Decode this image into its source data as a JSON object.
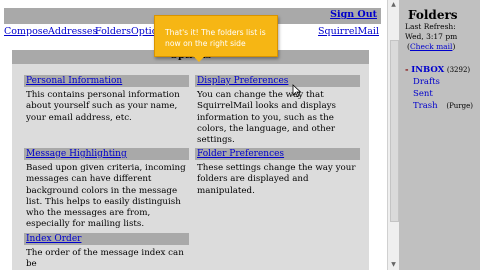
{
  "header": {
    "signout_label": "Sign Out"
  },
  "menu": {
    "compose": "Compose",
    "addresses": "Addresses",
    "folders": "Folders",
    "options": "Optio",
    "brand": "SquirrelMail"
  },
  "options_panel": {
    "title": "Options"
  },
  "blocks": {
    "personal": {
      "title": "Personal Information",
      "desc": "This contains personal information about yourself such as your name, your email address, etc."
    },
    "display": {
      "title": "Display Preferences",
      "desc": "You can change the way that SquirrelMail looks and displays information to you, such as the colors, the language, and other settings."
    },
    "highlight": {
      "title": "Message Highlighting",
      "desc": "Based upon given criteria, incoming messages can have different background colors in the message list. This helps to easily distinguish who the messages are from, especially for mailing lists."
    },
    "folder": {
      "title": "Folder Preferences",
      "desc": "These settings change the way your folders are displayed and manipulated."
    },
    "index": {
      "title": "Index Order",
      "desc": "The order of the message index can be"
    }
  },
  "sidebar": {
    "title": "Folders",
    "last_refresh_label": "Last Refresh:",
    "last_refresh_time": "Wed, 3:17 pm",
    "check_mail": "Check mail",
    "folders": {
      "inbox": {
        "marker": "-",
        "name": "INBOX",
        "count": "(3292)"
      },
      "drafts": {
        "name": "Drafts"
      },
      "sent": {
        "name": "Sent"
      },
      "trash": {
        "name": "Trash",
        "purge": "(Purge)"
      }
    }
  },
  "tooltip": {
    "line1": "That's it! The folders list is",
    "line2": "now on the right side"
  },
  "colors": {
    "link": "#0000cc",
    "header_bar": "#a9a9a9",
    "block_bg": "#dcdcdc",
    "sidebar_bg": "#c0c0c0",
    "tooltip_bg": "#f6b614",
    "inbox_marker": "#800000"
  },
  "icons": {
    "cursor": "mouse-pointer-icon",
    "scroll_up": "scroll-up-arrow-icon",
    "scroll_down": "scroll-down-arrow-icon"
  }
}
